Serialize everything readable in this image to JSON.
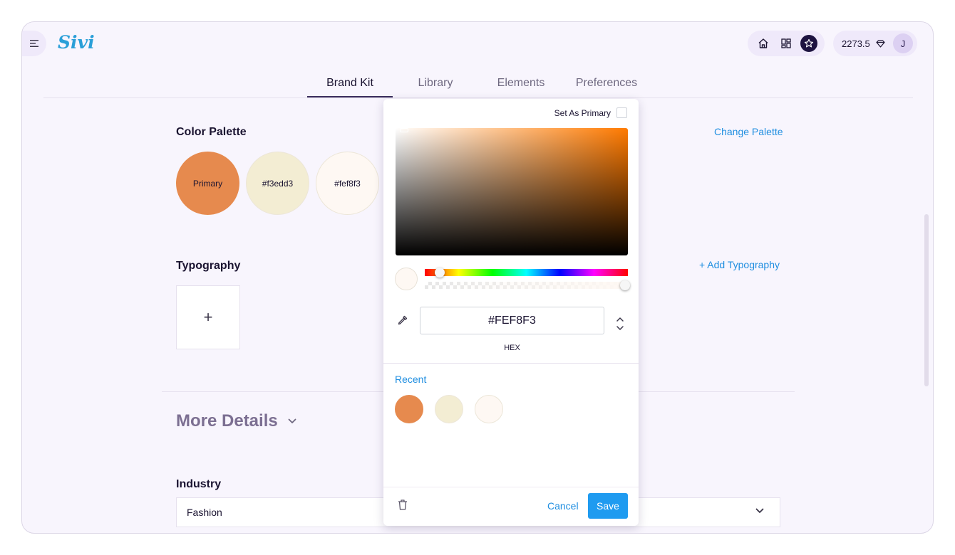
{
  "app": {
    "logo": "Sivi",
    "credits": "2273.5",
    "avatar_initial": "J"
  },
  "tabs": [
    {
      "label": "Brand Kit",
      "active": true
    },
    {
      "label": "Library",
      "active": false
    },
    {
      "label": "Elements",
      "active": false
    },
    {
      "label": "Preferences",
      "active": false
    }
  ],
  "color_palette": {
    "title": "Color Palette",
    "change_link": "Change Palette",
    "swatches": [
      {
        "label": "Primary",
        "color": "#e68a4e"
      },
      {
        "label": "#f3edd3",
        "color": "#f3edd3"
      },
      {
        "label": "#fef8f3",
        "color": "#fef8f3"
      }
    ]
  },
  "typography": {
    "title": "Typography",
    "add_link": "+ Add Typography",
    "add_tile": "+"
  },
  "more_details": {
    "title": "More Details"
  },
  "industry": {
    "label": "Industry",
    "value": "Fashion"
  },
  "picker": {
    "set_primary_label": "Set As Primary",
    "set_primary_checked": false,
    "hue_color": "#ff7a00",
    "hex_value": "#FEF8F3",
    "hex_mode_label": "HEX",
    "recent_label": "Recent",
    "recent_colors": [
      "#e68a4e",
      "#f3edd3",
      "#fef8f3"
    ],
    "cancel_label": "Cancel",
    "save_label": "Save"
  },
  "colors": {
    "accent": "#1f8ee0",
    "save_button": "#1f9bf0",
    "background": "#f8f5fd"
  },
  "icons": [
    "menu-icon",
    "home-icon",
    "grid-icon",
    "star-icon",
    "gem-icon",
    "chevron-down-icon",
    "eyedropper-icon",
    "chevron-updown-icon",
    "trash-icon"
  ]
}
